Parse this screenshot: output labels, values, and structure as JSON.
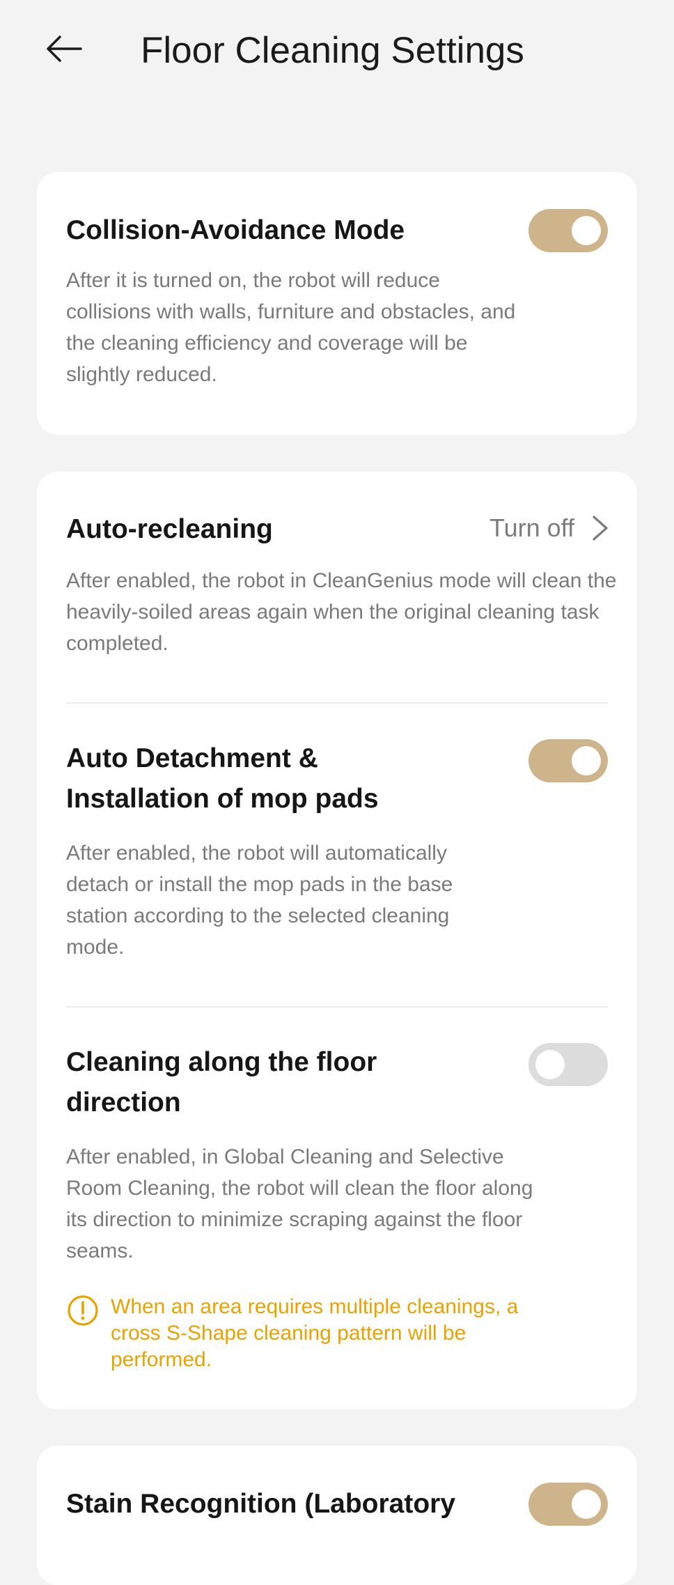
{
  "header": {
    "title": "Floor Cleaning Settings",
    "back_icon": "arrow-left-icon"
  },
  "settings": {
    "collision_avoidance": {
      "title": "Collision-Avoidance Mode",
      "description": "After it is turned on, the robot will reduce collisions with walls, furniture and obstacles, and the cleaning efficiency and coverage will be slightly reduced.",
      "enabled": true
    },
    "auto_recleaning": {
      "title": "Auto-recleaning",
      "value": "Turn off",
      "description": "After enabled, the robot in CleanGenius mode will clean the heavily-soiled areas again when the original cleaning task completed."
    },
    "auto_detachment": {
      "title": "Auto Detachment & Installation of mop pads",
      "description": "After enabled, the robot will automatically detach or install the mop pads in the base station according to the selected cleaning mode.",
      "enabled": true
    },
    "floor_direction": {
      "title": "Cleaning along the floor direction",
      "description": "After enabled, in Global Cleaning and Selective Room Cleaning, the robot will clean the floor along its direction to minimize scraping against the floor seams.",
      "enabled": false,
      "warning": "When an area requires multiple cleanings, a cross S-Shape cleaning pattern will be performed."
    },
    "stain_recognition": {
      "title": "Stain Recognition (Laboratory",
      "enabled": true
    }
  },
  "colors": {
    "toggle_on": "#cdb48a",
    "toggle_off": "#dcdcdc",
    "warning": "#e9a200",
    "background": "#f3f3f3"
  }
}
